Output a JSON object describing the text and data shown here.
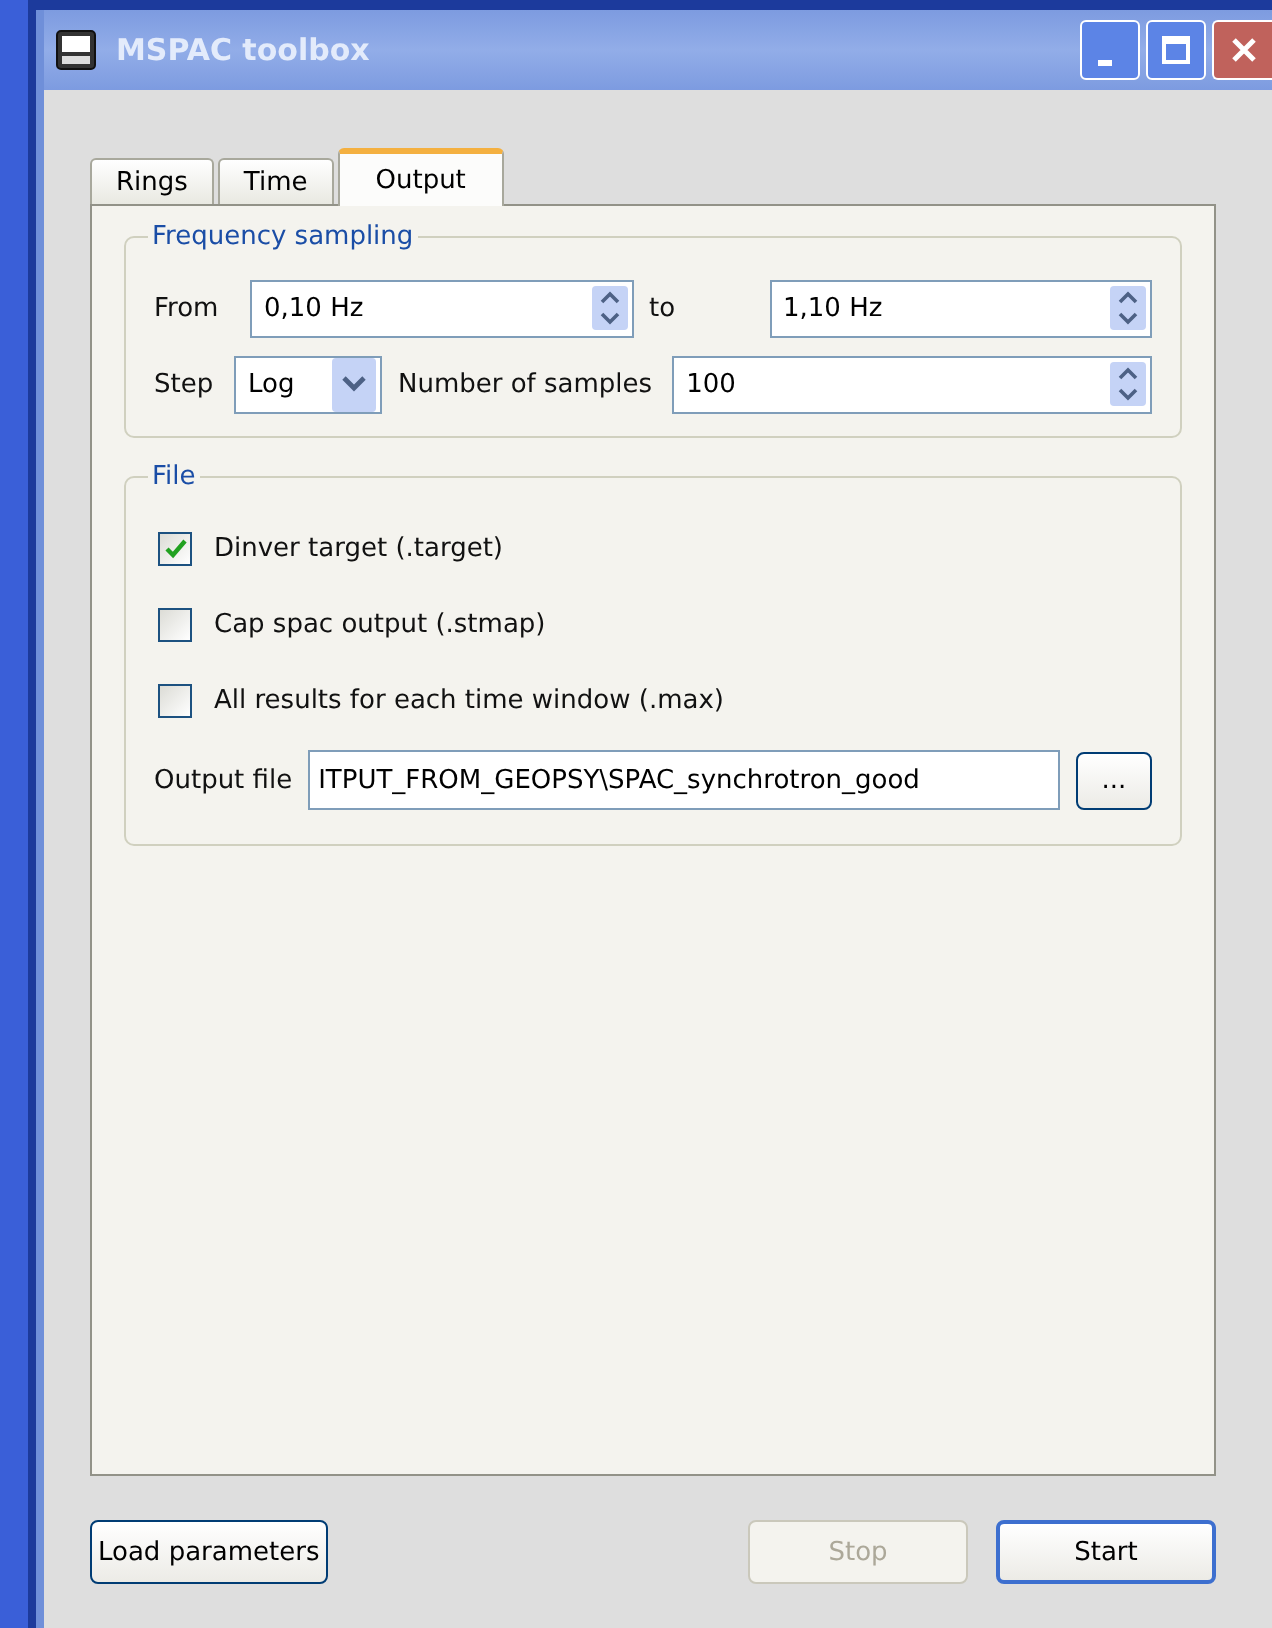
{
  "window": {
    "title": "MSPAC toolbox"
  },
  "tabs": [
    {
      "label": "Rings",
      "selected": false
    },
    {
      "label": "Time",
      "selected": false
    },
    {
      "label": "Output",
      "selected": true
    }
  ],
  "frequency_sampling": {
    "title": "Frequency sampling",
    "from_label": "From",
    "from_value": "0,10 Hz",
    "to_label": "to",
    "to_value": "1,10 Hz",
    "step_label": "Step",
    "step_value": "Log",
    "samples_label": "Number of samples",
    "samples_value": "100"
  },
  "file": {
    "title": "File",
    "options": [
      {
        "label": "Dinver target (.target)",
        "checked": true
      },
      {
        "label": "Cap spac output (.stmap)",
        "checked": false
      },
      {
        "label": "All results for each time window (.max)",
        "checked": false
      }
    ],
    "output_label": "Output file",
    "output_value": "ITPUT_FROM_GEOPSY\\SPAC_synchrotron_good",
    "browse": "..."
  },
  "buttons": [
    {
      "label": "Load parameters",
      "disabled": false,
      "kind": "left"
    },
    {
      "label": "Stop",
      "disabled": true,
      "kind": "right"
    },
    {
      "label": "Start",
      "disabled": false,
      "kind": "right"
    }
  ]
}
